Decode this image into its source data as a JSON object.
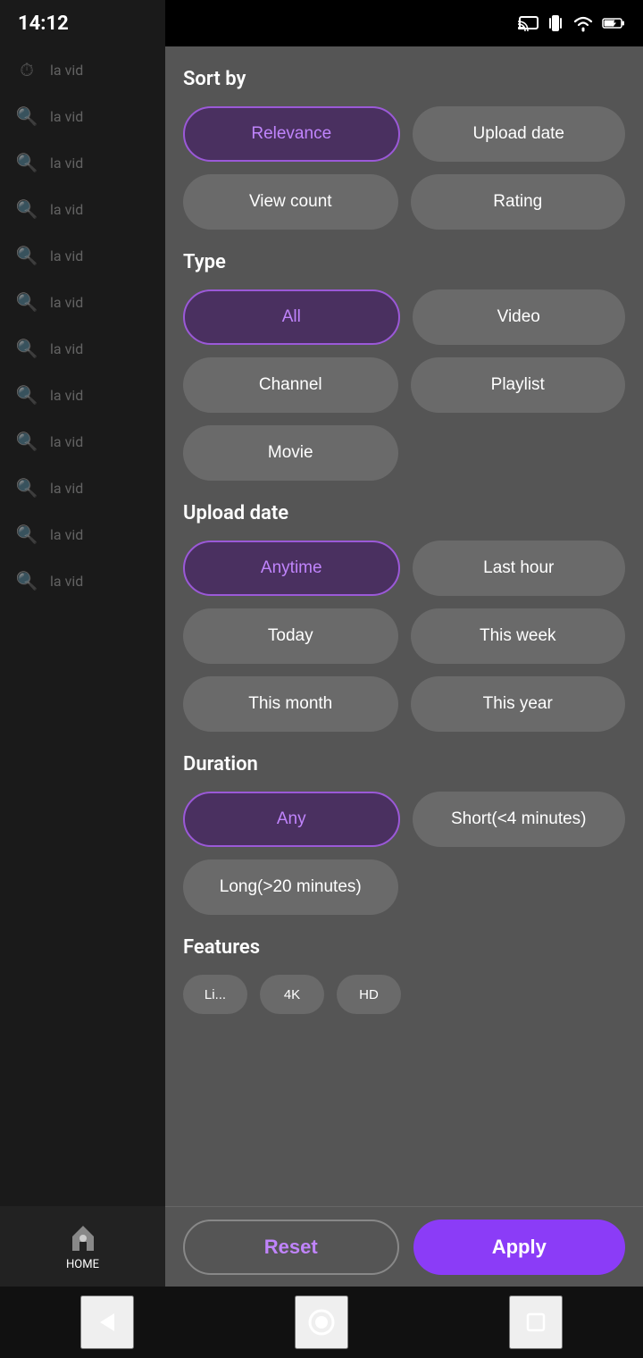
{
  "statusBar": {
    "time": "14:12"
  },
  "background": {
    "rows": [
      {
        "icon": "⏱",
        "text": "la vid"
      },
      {
        "icon": "🔍",
        "text": "la vid"
      },
      {
        "icon": "🔍",
        "text": "la vid"
      },
      {
        "icon": "🔍",
        "text": "la vid"
      },
      {
        "icon": "🔍",
        "text": "la vid"
      },
      {
        "icon": "🔍",
        "text": "la vid"
      },
      {
        "icon": "🔍",
        "text": "la vid"
      },
      {
        "icon": "🔍",
        "text": "la vid"
      },
      {
        "icon": "🔍",
        "text": "la vid"
      },
      {
        "icon": "🔍",
        "text": "la vid"
      },
      {
        "icon": "🔍",
        "text": "la vid"
      },
      {
        "icon": "🔍",
        "text": "la vid"
      }
    ]
  },
  "panel": {
    "sortBy": {
      "sectionLabel": "Sort by",
      "options": [
        {
          "label": "Relevance",
          "selected": true
        },
        {
          "label": "Upload date",
          "selected": false
        },
        {
          "label": "View count",
          "selected": false
        },
        {
          "label": "Rating",
          "selected": false
        }
      ]
    },
    "type": {
      "sectionLabel": "Type",
      "options": [
        {
          "label": "All",
          "selected": true
        },
        {
          "label": "Video",
          "selected": false
        },
        {
          "label": "Channel",
          "selected": false
        },
        {
          "label": "Playlist",
          "selected": false
        },
        {
          "label": "Movie",
          "selected": false
        }
      ]
    },
    "uploadDate": {
      "sectionLabel": "Upload date",
      "options": [
        {
          "label": "Anytime",
          "selected": true
        },
        {
          "label": "Last hour",
          "selected": false
        },
        {
          "label": "Today",
          "selected": false
        },
        {
          "label": "This week",
          "selected": false
        },
        {
          "label": "This month",
          "selected": false
        },
        {
          "label": "This year",
          "selected": false
        }
      ]
    },
    "duration": {
      "sectionLabel": "Duration",
      "options": [
        {
          "label": "Any",
          "selected": true
        },
        {
          "label": "Short(<4 minutes)",
          "selected": false
        },
        {
          "label": "Long(>20 minutes)",
          "selected": false
        }
      ]
    },
    "features": {
      "sectionLabel": "Features",
      "partialOptions": [
        {
          "label": "Li..."
        },
        {
          "label": "4K"
        },
        {
          "label": "HD"
        }
      ]
    }
  },
  "actions": {
    "resetLabel": "Reset",
    "applyLabel": "Apply"
  },
  "homeNav": {
    "label": "HOME"
  },
  "navBar": {
    "back": "◀",
    "home": "⬤",
    "square": "■"
  }
}
